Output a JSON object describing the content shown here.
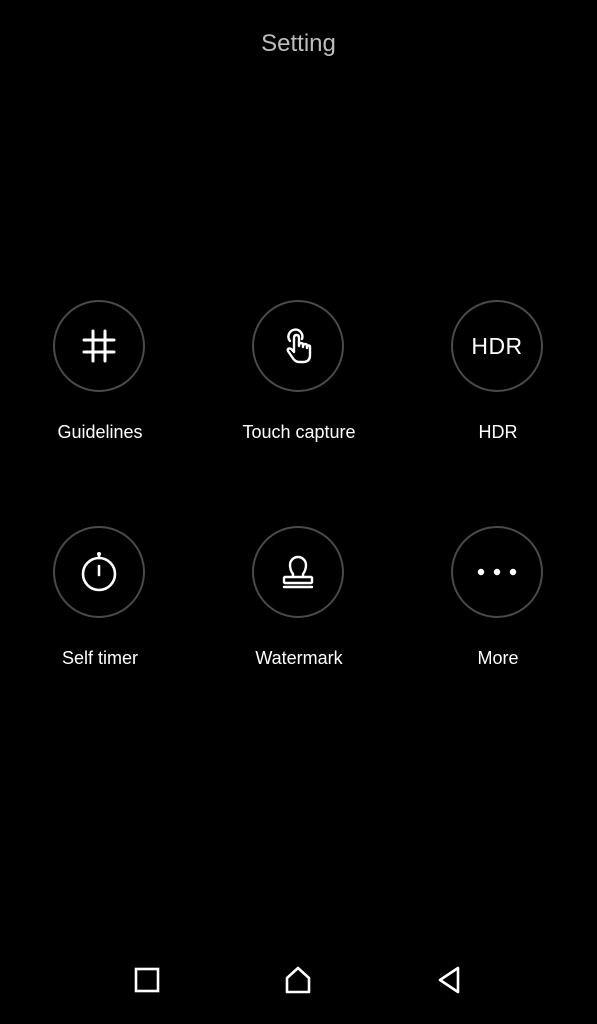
{
  "header": {
    "title": "Setting"
  },
  "settings": [
    {
      "label": "Guidelines",
      "icon": "grid-icon"
    },
    {
      "label": "Touch capture",
      "icon": "touch-icon"
    },
    {
      "label": "HDR",
      "icon": "hdr-icon",
      "icon_text": "HDR"
    },
    {
      "label": "Self timer",
      "icon": "timer-icon"
    },
    {
      "label": "Watermark",
      "icon": "stamp-icon"
    },
    {
      "label": "More",
      "icon": "more-icon"
    }
  ],
  "navbar": {
    "items": [
      "recent-apps-icon",
      "home-icon",
      "back-icon"
    ]
  },
  "colors": {
    "background": "#000000",
    "ring": "#4a4a4a",
    "title": "#bdbdbd",
    "text": "#ffffff"
  }
}
